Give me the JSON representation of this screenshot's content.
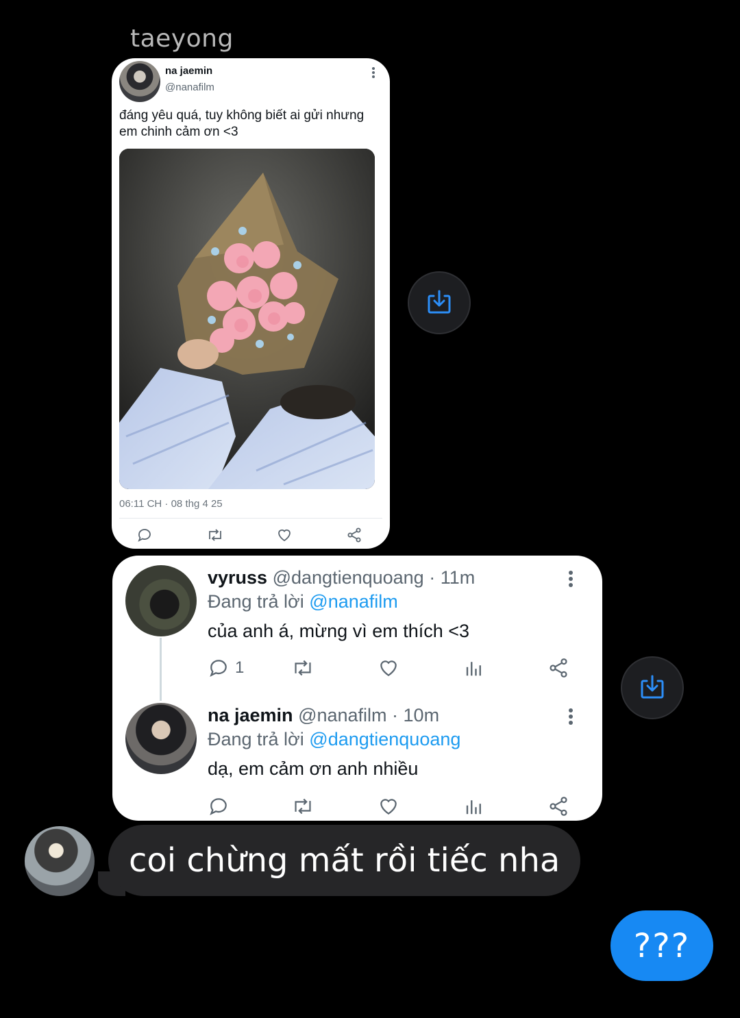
{
  "chat": {
    "sender_name": "taeyong",
    "incoming_message": "coi chừng mất rồi tiếc nha",
    "outgoing_message": "???",
    "colors": {
      "incoming_bubble": "#262628",
      "outgoing_bubble": "#1789f3",
      "background": "#000000"
    }
  },
  "shared_tweet": {
    "display_name": "na jaemin",
    "handle": "@nanafilm",
    "text": "đáng yêu quá, tuy không biết ai gửi nhưng em chinh cảm ơn <3",
    "timestamp": "06:11 CH · 08 thg 4 25",
    "actions": [
      "reply-icon",
      "retweet-icon",
      "like-icon",
      "share-icon"
    ]
  },
  "shared_thread": {
    "replies": [
      {
        "display_name": "vyruss",
        "handle": "@dangtienquoang",
        "time": "· 11m",
        "replying_to_prefix": "Đang trả lời",
        "replying_to": "@nanafilm",
        "text": "của anh á, mừng vì em thích <3",
        "reply_count": "1"
      },
      {
        "display_name": "na jaemin",
        "handle": "@nanafilm",
        "time": "· 10m",
        "replying_to_prefix": "Đang trả lời",
        "replying_to": "@dangtienquoang",
        "text": "dạ, em cảm ơn anh nhiều",
        "reply_count": ""
      }
    ],
    "accent": "#1d9bf0"
  }
}
